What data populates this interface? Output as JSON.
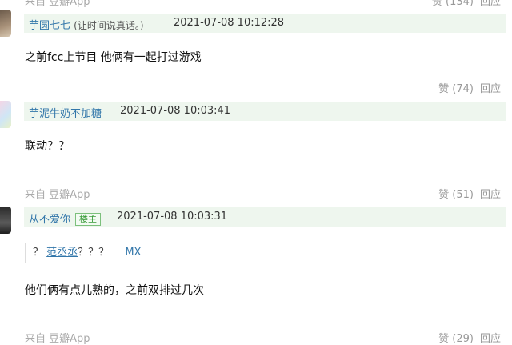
{
  "top_footer": {
    "source": "来自 豆瓣App",
    "vote_label": "赞 (134)",
    "reply_label": "回应"
  },
  "comments": [
    {
      "author": "芋圆七七",
      "author_note": "(让时间说真话。)",
      "time": "2021-07-08 10:12:28",
      "content": "之前fcc上节目 他俩有一起打过游戏",
      "vote_label": "赞 (74)",
      "reply_label": "回应"
    },
    {
      "author": "芋泥牛奶不加糖",
      "time": "2021-07-08 10:03:41",
      "content": "联动？？",
      "source": "来自 豆瓣App",
      "vote_label": "赞 (51)",
      "reply_label": "回应"
    },
    {
      "author": "从不爱你",
      "badge": "楼主",
      "time": "2021-07-08 10:03:31",
      "quote_prefix": "？",
      "quote_author": "范丞丞",
      "quote_text": "？？？",
      "quote_source": "MX",
      "content": "他们俩有点儿熟的，之前双排过几次",
      "source": "来自 豆瓣App",
      "vote_label": "赞 (29)",
      "reply_label": "回应"
    }
  ],
  "colors": {
    "header_bg": "#eef6ee",
    "link": "#3377aa",
    "badge_green": "#3a9c3a"
  }
}
